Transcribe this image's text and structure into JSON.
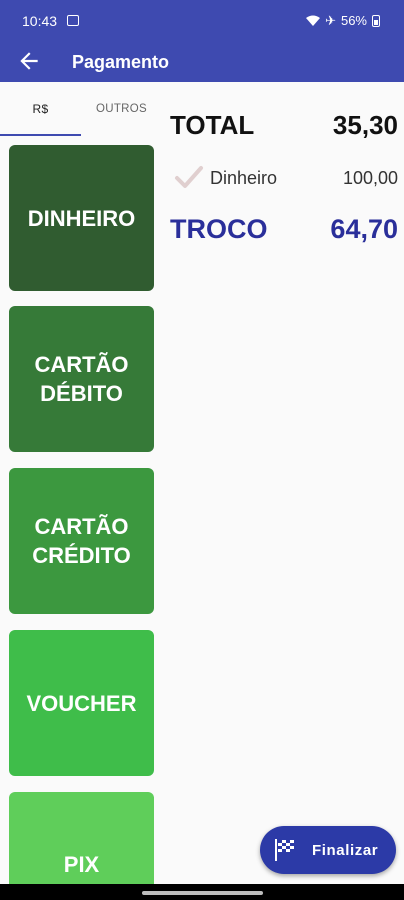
{
  "status_bar": {
    "time": "10:43",
    "battery": "56%"
  },
  "app_bar": {
    "title": "Pagamento"
  },
  "tabs": [
    {
      "label": "R$"
    },
    {
      "label": "OUTROS"
    }
  ],
  "payment_methods": [
    {
      "label": "DINHEIRO",
      "color": "#305c30"
    },
    {
      "label": "CARTÃO DÉBITO",
      "color": "#367a38"
    },
    {
      "label": "CARTÃO CRÉDITO",
      "color": "#3c983f"
    },
    {
      "label": "VOUCHER",
      "color": "#3fbd4a"
    },
    {
      "label": "PIX",
      "color": "#5fce5a"
    }
  ],
  "summary": {
    "total_label": "TOTAL",
    "total_value": "35,30",
    "payments": [
      {
        "name": "Dinheiro",
        "amount": "100,00",
        "icon": "check-icon"
      }
    ],
    "troco_label": "TROCO",
    "troco_value": "64,70"
  },
  "fab": {
    "label": "Finalizar",
    "icon": "flag-icon"
  },
  "colors": {
    "primary": "#3e4ab0",
    "troco": "#2a2f9a",
    "fab": "#2c3aa7"
  }
}
